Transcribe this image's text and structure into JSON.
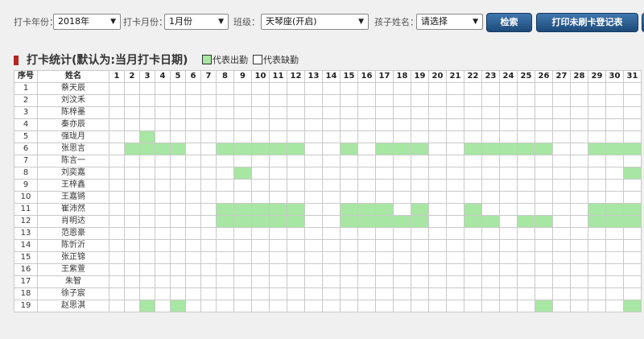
{
  "filters": {
    "year_label": "打卡年份：",
    "year_value": "2018年",
    "month_label": "打卡月份：",
    "month_value": "1月份",
    "class_label": "班级：",
    "class_value": "天琴座(开启)",
    "child_label": "孩子姓名：",
    "child_value": "请选择",
    "search_button": "检索",
    "print_button": "打印未刷卡登记表"
  },
  "section": {
    "title": "打卡统计(默认为:当月打卡日期)",
    "legend_present": "代表出勤",
    "legend_absent": "代表缺勤"
  },
  "colors": {
    "present": "#a8e6a3",
    "button": "#2a5a8e",
    "title_mark": "#b62424"
  },
  "table": {
    "col_no": "序号",
    "col_name": "姓名",
    "days": [
      "1",
      "2",
      "3",
      "4",
      "5",
      "6",
      "7",
      "8",
      "9",
      "10",
      "11",
      "12",
      "13",
      "14",
      "15",
      "16",
      "17",
      "18",
      "19",
      "20",
      "21",
      "22",
      "23",
      "24",
      "25",
      "26",
      "27",
      "28",
      "29",
      "30",
      "31"
    ],
    "rows": [
      {
        "no": "1",
        "name": "蔡天辰",
        "present": []
      },
      {
        "no": "2",
        "name": "刘汶禾",
        "present": []
      },
      {
        "no": "3",
        "name": "陈梓墨",
        "present": []
      },
      {
        "no": "4",
        "name": "秦亦辰",
        "present": []
      },
      {
        "no": "5",
        "name": "强珑月",
        "present": [
          3
        ]
      },
      {
        "no": "6",
        "name": "张思言",
        "present": [
          2,
          3,
          4,
          5,
          8,
          9,
          10,
          11,
          12,
          15,
          17,
          18,
          19,
          22,
          23,
          24,
          25,
          26,
          29,
          30,
          31
        ]
      },
      {
        "no": "7",
        "name": "陈言一",
        "present": []
      },
      {
        "no": "8",
        "name": "刘奕嘉",
        "present": [
          9,
          31
        ]
      },
      {
        "no": "9",
        "name": "王梓鑫",
        "present": []
      },
      {
        "no": "10",
        "name": "王嘉锵",
        "present": []
      },
      {
        "no": "11",
        "name": "崔沛然",
        "present": [
          8,
          9,
          10,
          11,
          12,
          15,
          16,
          17,
          19,
          22,
          29,
          30,
          31
        ]
      },
      {
        "no": "12",
        "name": "肖明达",
        "present": [
          8,
          9,
          10,
          11,
          12,
          15,
          16,
          17,
          18,
          19,
          22,
          23,
          25,
          26,
          29,
          30,
          31
        ]
      },
      {
        "no": "13",
        "name": "范恩豪",
        "present": []
      },
      {
        "no": "14",
        "name": "陈忻沂",
        "present": []
      },
      {
        "no": "15",
        "name": "张正锦",
        "present": []
      },
      {
        "no": "16",
        "name": "王紫萱",
        "present": []
      },
      {
        "no": "17",
        "name": "朱智",
        "present": []
      },
      {
        "no": "18",
        "name": "徐子宸",
        "present": []
      },
      {
        "no": "19",
        "name": "赵思淇",
        "present": [
          3,
          5,
          26,
          31
        ]
      }
    ]
  }
}
